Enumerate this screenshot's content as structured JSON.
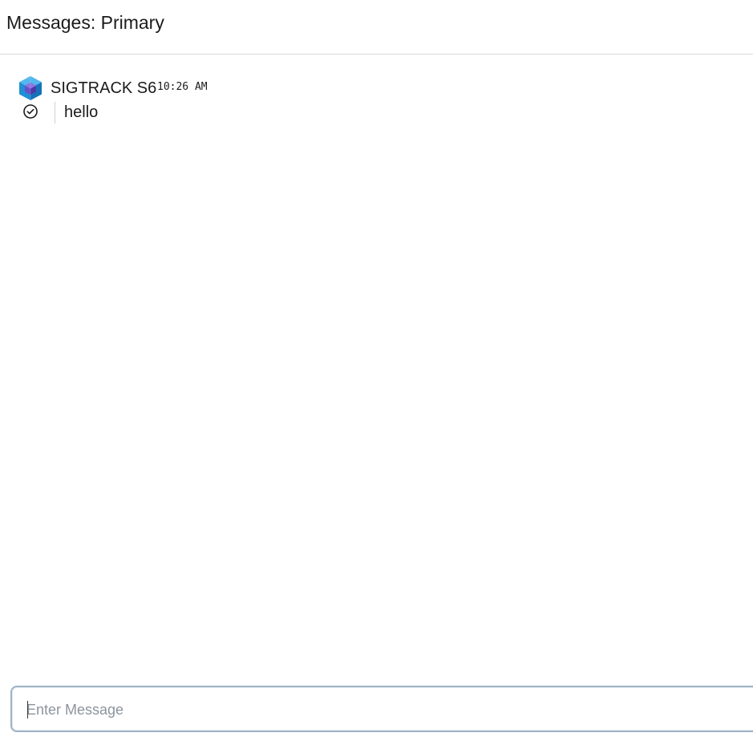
{
  "header": {
    "title": "Messages: Primary"
  },
  "messages": [
    {
      "avatar_icon": "cube-logo-icon",
      "sender": "SIGTRACK S6",
      "time": "10:26 AM",
      "status_icon": "check-circle-icon",
      "text": "hello"
    }
  ],
  "composer": {
    "placeholder": "Enter Message",
    "value": ""
  },
  "colors": {
    "composer_border": "#9fb3c4",
    "avatar_blue": "#1f8fd6",
    "avatar_purple": "#6a4fc7"
  }
}
